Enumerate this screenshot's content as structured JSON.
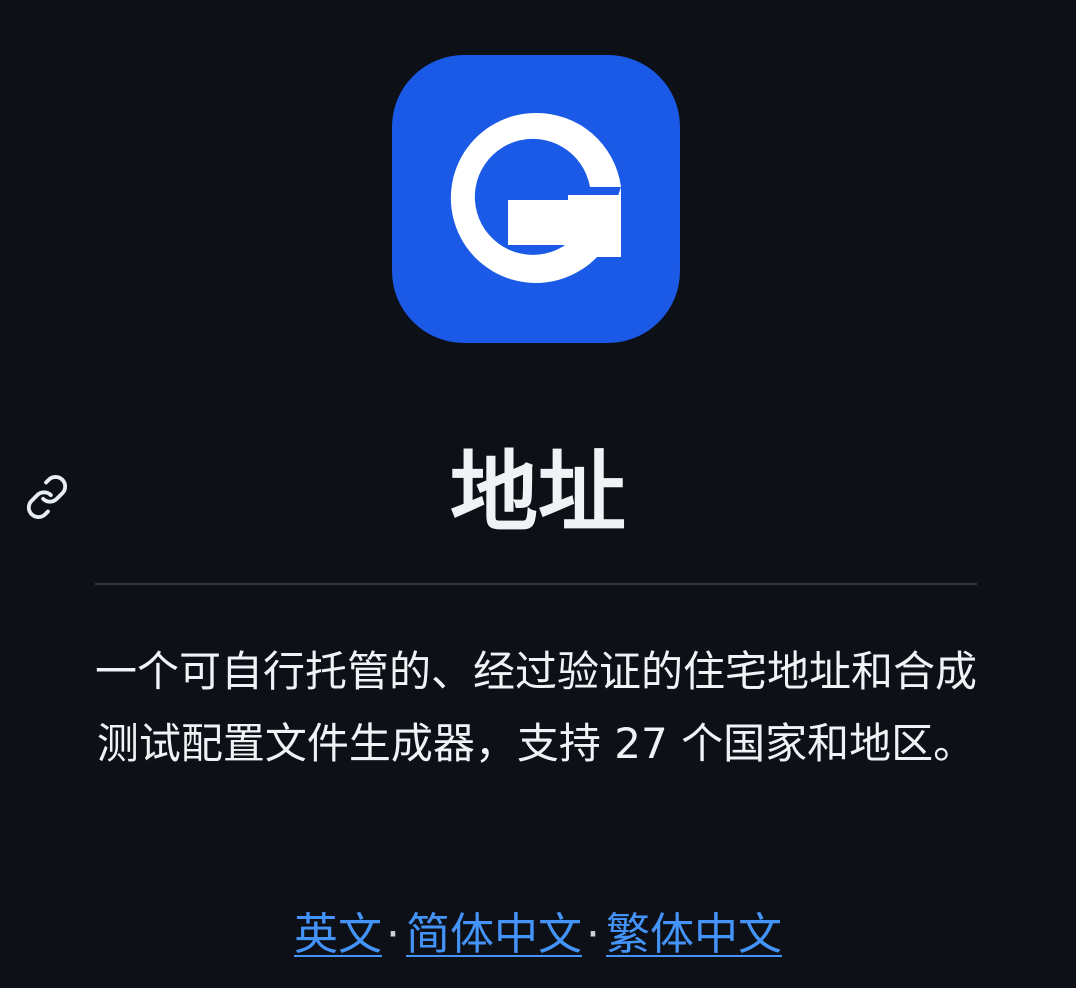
{
  "logo": {
    "icon": "g-letter-logo-icon",
    "color": "#1b5ae6"
  },
  "anchor": {
    "icon": "link-icon"
  },
  "heading": {
    "title": "地址"
  },
  "description": {
    "text": "一个可自行托管的、经过验证的住宅地址和合成测试配置文件生成器，支持 27 个国家和地区。"
  },
  "languages": {
    "items": [
      {
        "label": "英文"
      },
      {
        "label": "简体中文"
      },
      {
        "label": "繁体中文"
      }
    ],
    "separator": "·"
  },
  "colors": {
    "background": "#0d1117",
    "text": "#f0f3f6",
    "link": "#4493f8",
    "divider": "#30363d"
  }
}
